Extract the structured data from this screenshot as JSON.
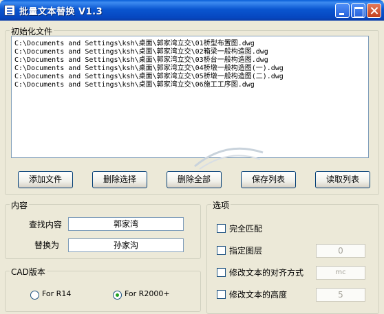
{
  "window": {
    "title": "批量文本替换 V1.3"
  },
  "file_group": {
    "title": "初始化文件",
    "files": [
      "C:\\Documents and Settings\\ksh\\桌面\\郭家湾立交\\01桥型布置图.dwg",
      "C:\\Documents and Settings\\ksh\\桌面\\郭家湾立交\\02箱梁一般构造图.dwg",
      "C:\\Documents and Settings\\ksh\\桌面\\郭家湾立交\\03桥台一般构造图.dwg",
      "C:\\Documents and Settings\\ksh\\桌面\\郭家湾立交\\04桥墩一般构造图(一).dwg",
      "C:\\Documents and Settings\\ksh\\桌面\\郭家湾立交\\05桥墩一般构造图(二).dwg",
      "C:\\Documents and Settings\\ksh\\桌面\\郭家湾立交\\06施工工序图.dwg"
    ]
  },
  "buttons": {
    "add_file": "添加文件",
    "delete_selected": "删除选择",
    "delete_all": "删除全部",
    "save_list": "保存列表",
    "read_list": "读取列表"
  },
  "content_group": {
    "title": "内容",
    "find_label": "查找内容",
    "find_value": "郭家湾",
    "replace_label": "替换为",
    "replace_value": "孙家沟"
  },
  "cad_group": {
    "title": "CAD版本",
    "r14_label": "For R14",
    "r2000_label": "For R2000+",
    "selected": "For R2000+"
  },
  "options_group": {
    "title": "选项",
    "exact_match": "完全匹配",
    "layer_label": "指定图层",
    "layer_value": "0",
    "align_label": "修改文本的对齐方式",
    "align_value": "mc",
    "height_label": "修改文本的高度",
    "height_value": "5"
  },
  "colors": {
    "titlebar": "#0a56d0",
    "face": "#ece9d8",
    "border": "#003c74"
  }
}
